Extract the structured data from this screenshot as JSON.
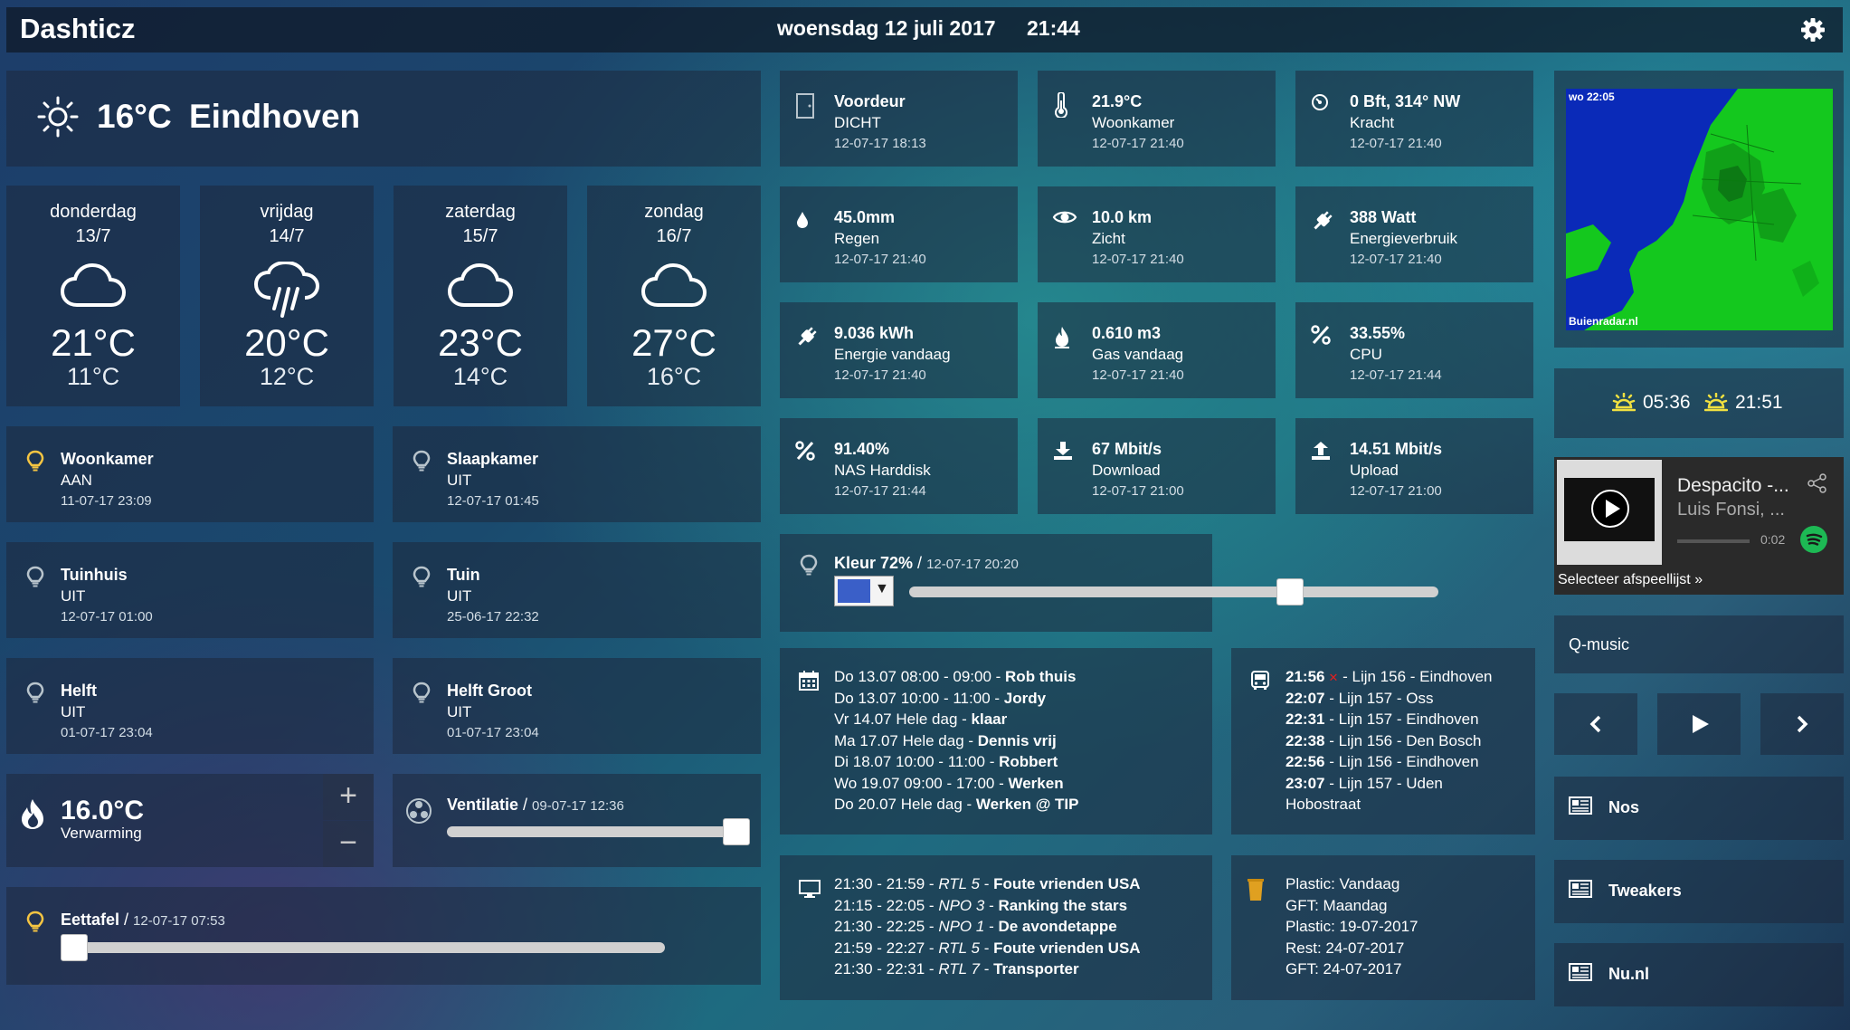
{
  "header": {
    "title": "Dashticz",
    "date": "woensdag 12 juli 2017",
    "time": "21:44"
  },
  "weather_now": {
    "temp": "16°C",
    "city": "Eindhoven"
  },
  "forecast": [
    {
      "day": "donderdag",
      "date": "13/7",
      "hi": "21°C",
      "lo": "11°C",
      "icon": "cloud-icon"
    },
    {
      "day": "vrijdag",
      "date": "14/7",
      "hi": "20°C",
      "lo": "12°C",
      "icon": "rain-cloud-icon"
    },
    {
      "day": "zaterdag",
      "date": "15/7",
      "hi": "23°C",
      "lo": "14°C",
      "icon": "cloud-icon"
    },
    {
      "day": "zondag",
      "date": "16/7",
      "hi": "27°C",
      "lo": "16°C",
      "icon": "cloud-icon"
    }
  ],
  "switches": [
    {
      "name": "Woonkamer",
      "state": "AAN",
      "time": "11-07-17 23:09",
      "on": true
    },
    {
      "name": "Slaapkamer",
      "state": "UIT",
      "time": "12-07-17 01:45",
      "on": false
    },
    {
      "name": "Tuinhuis",
      "state": "UIT",
      "time": "12-07-17 01:00",
      "on": false
    },
    {
      "name": "Tuin",
      "state": "UIT",
      "time": "25-06-17 22:32",
      "on": false
    },
    {
      "name": "Helft",
      "state": "UIT",
      "time": "01-07-17 23:04",
      "on": false
    },
    {
      "name": "Helft Groot",
      "state": "UIT",
      "time": "01-07-17 23:04",
      "on": false
    }
  ],
  "heating": {
    "temp": "16.0°C",
    "label": "Verwarming",
    "plus": "+",
    "minus": "−"
  },
  "ventilation": {
    "name": "Ventilatie",
    "time": "09-07-17 12:36",
    "level": 1.0
  },
  "dinner_table": {
    "name": "Eettafel",
    "time": "12-07-17 07:53",
    "level": 0.0
  },
  "sensors": [
    {
      "value": "Voordeur",
      "label": "DICHT",
      "time": "12-07-17 18:13",
      "icon": "door-icon"
    },
    {
      "value": "21.9°C",
      "label": "Woonkamer",
      "time": "12-07-17 21:40",
      "icon": "thermometer-icon"
    },
    {
      "value": "0 Bft, 314° NW",
      "label": "Kracht",
      "time": "12-07-17 21:40",
      "icon": "wind-compass-icon"
    },
    {
      "value": "45.0mm",
      "label": "Regen",
      "time": "12-07-17 21:40",
      "icon": "raindrop-icon"
    },
    {
      "value": "10.0 km",
      "label": "Zicht",
      "time": "12-07-17 21:40",
      "icon": "eye-icon"
    },
    {
      "value": "388 Watt",
      "label": "Energieverbruik",
      "time": "12-07-17 21:40",
      "icon": "plug-icon"
    },
    {
      "value": "9.036 kWh",
      "label": "Energie vandaag",
      "time": "12-07-17 21:40",
      "icon": "plug-icon"
    },
    {
      "value": "0.610 m3",
      "label": "Gas vandaag",
      "time": "12-07-17 21:40",
      "icon": "flame-icon"
    },
    {
      "value": "33.55%",
      "label": "CPU",
      "time": "12-07-17 21:44",
      "icon": "percent-icon"
    },
    {
      "value": "91.40%",
      "label": "NAS Harddisk",
      "time": "12-07-17 21:44",
      "icon": "percent-icon"
    },
    {
      "value": "67 Mbit/s",
      "label": "Download",
      "time": "12-07-17 21:00",
      "icon": "download-icon"
    },
    {
      "value": "14.51 Mbit/s",
      "label": "Upload",
      "time": "12-07-17 21:00",
      "icon": "upload-icon"
    }
  ],
  "color_light": {
    "name": "Kleur 72%",
    "time": "12-07-17 20:20",
    "swatch": "#3a5fc8",
    "level": 0.72
  },
  "calendar": [
    {
      "when": "Do 13.07 08:00 - 09:00 - ",
      "what": "Rob thuis"
    },
    {
      "when": "Do 13.07 10:00 - 11:00 - ",
      "what": "Jordy"
    },
    {
      "when": "Vr 14.07 Hele dag - ",
      "what": "klaar"
    },
    {
      "when": "Ma 17.07 Hele dag - ",
      "what": "Dennis vrij"
    },
    {
      "when": "Di 18.07 10:00 - 11:00 - ",
      "what": "Robbert"
    },
    {
      "when": "Wo 19.07 09:00 - 17:00 - ",
      "what": "Werken"
    },
    {
      "when": "Do 20.07 Hele dag - ",
      "what": "Werken @ TIP"
    }
  ],
  "bus": {
    "items": [
      {
        "time": "21:56",
        "line": " - Lijn 156 - Eindhoven",
        "delay": true
      },
      {
        "time": "22:07",
        "line": " - Lijn 157 - Oss",
        "delay": false
      },
      {
        "time": "22:31",
        "line": " - Lijn 157 - Eindhoven",
        "delay": false
      },
      {
        "time": "22:38",
        "line": " - Lijn 156 - Den Bosch",
        "delay": false
      },
      {
        "time": "22:56",
        "line": " - Lijn 156 - Eindhoven",
        "delay": false
      },
      {
        "time": "23:07",
        "line": " - Lijn 157 - Uden",
        "delay": false
      }
    ],
    "stop": "Hobostraat"
  },
  "tv": [
    {
      "time": "21:30 - 21:59 - ",
      "channel": "RTL 5",
      "title": "Foute vrienden USA"
    },
    {
      "time": "21:15 - 22:05 - ",
      "channel": "NPO 3",
      "title": "Ranking the stars"
    },
    {
      "time": "21:30 - 22:25 - ",
      "channel": "NPO 1",
      "title": "De avondetappe"
    },
    {
      "time": "21:59 - 22:27 - ",
      "channel": "RTL 5",
      "title": "Foute vrienden USA"
    },
    {
      "time": "21:30 - 22:31 - ",
      "channel": "RTL 7",
      "title": "Transporter"
    }
  ],
  "garbage": [
    "Plastic: Vandaag",
    "GFT: Maandag",
    "Plastic: 19-07-2017",
    "Rest: 24-07-2017",
    "GFT: 24-07-2017"
  ],
  "radar": {
    "stamp": "wo 22:05",
    "credit": "Buienradar.nl"
  },
  "sun": {
    "rise": "05:36",
    "set": "21:51"
  },
  "spotify": {
    "track": "Despacito -...",
    "artist": "Luis Fonsi, ...",
    "elapsed": "0:02",
    "playlist": "Selecteer afspeellijst »"
  },
  "radio": {
    "station": "Q-music"
  },
  "news": [
    {
      "label": "Nos"
    },
    {
      "label": "Tweakers"
    },
    {
      "label": "Nu.nl"
    }
  ],
  "colors": {
    "bulb_on": "#f5c542",
    "bulb_off": "#b8c4cc",
    "sun": "#f0e040",
    "bin": "#e0a020"
  }
}
